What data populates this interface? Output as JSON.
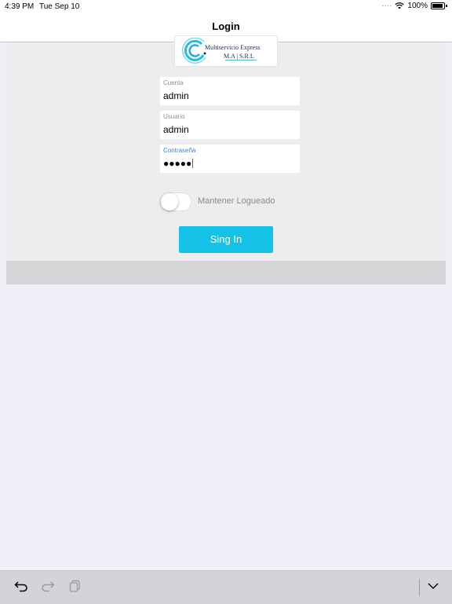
{
  "status_bar": {
    "time": "4:39 PM",
    "date": "Tue Sep 10",
    "battery": "100%"
  },
  "nav": {
    "title": "Login"
  },
  "logo": {
    "line1": "Multiservicio Express",
    "line2": "M.A | S.R.L"
  },
  "form": {
    "cuenta": {
      "label": "Cuenta",
      "value": "admin"
    },
    "usuario": {
      "label": "Usuario",
      "value": "admin"
    },
    "password": {
      "label": "Contraseña",
      "value": "●●●●●"
    }
  },
  "keep_logged": {
    "label": "Mantener Logueado",
    "on": false
  },
  "sign_in": {
    "label": "Sing In"
  },
  "colors": {
    "accent": "#13c2e6",
    "active_label": "#1a8cff"
  },
  "bottom_toolbar": {
    "icons": [
      "undo-icon",
      "redo-icon",
      "clipboard-icon",
      "chevron-down-icon"
    ]
  }
}
